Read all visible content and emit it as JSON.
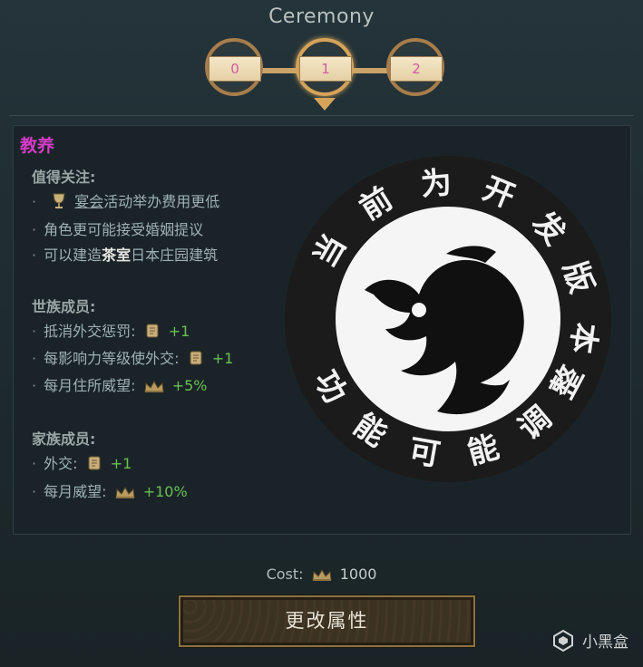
{
  "header": {
    "title": "Ceremony"
  },
  "levels": {
    "items": [
      "0",
      "1",
      "2"
    ],
    "active_index": 1
  },
  "content": {
    "title": "教养",
    "notable": {
      "heading": "值得关注:",
      "items": [
        {
          "prefix": "",
          "underline": "宴会",
          "middle": "活动举办费用更低",
          "bold": "",
          "suffix": ""
        },
        {
          "prefix": "",
          "underline": "",
          "middle": "角色更可能接受婚姻提议",
          "bold": "",
          "suffix": ""
        },
        {
          "prefix": "可以建造",
          "underline": "",
          "middle": "",
          "bold": "茶室",
          "suffix": "日本庄园建筑"
        }
      ]
    },
    "dynasty": {
      "heading": "世族成员:",
      "items": [
        {
          "label": "抵消外交惩罚:",
          "icon": "scroll-icon",
          "value": "+1"
        },
        {
          "label": "每影响力等级使外交:",
          "icon": "scroll-icon",
          "value": "+1"
        },
        {
          "label": "每月住所威望:",
          "icon": "crown-icon",
          "value": "+5%"
        }
      ]
    },
    "house": {
      "heading": "家族成员:",
      "items": [
        {
          "label": "外交:",
          "icon": "scroll-icon",
          "value": "+1"
        },
        {
          "label": "每月威望:",
          "icon": "crown-icon",
          "value": "+10%"
        }
      ]
    }
  },
  "seal": {
    "text": "当前为开发版本功能可能调整",
    "colors": {
      "ring": "#1b1b1b",
      "inner": "#f5f5f5",
      "emblem": "#101010"
    }
  },
  "footer": {
    "cost_label": "Cost:",
    "cost_icon": "crown-icon",
    "cost_value": "1000",
    "button_label": "更改属性"
  },
  "watermark": {
    "text": "小黑盒"
  }
}
